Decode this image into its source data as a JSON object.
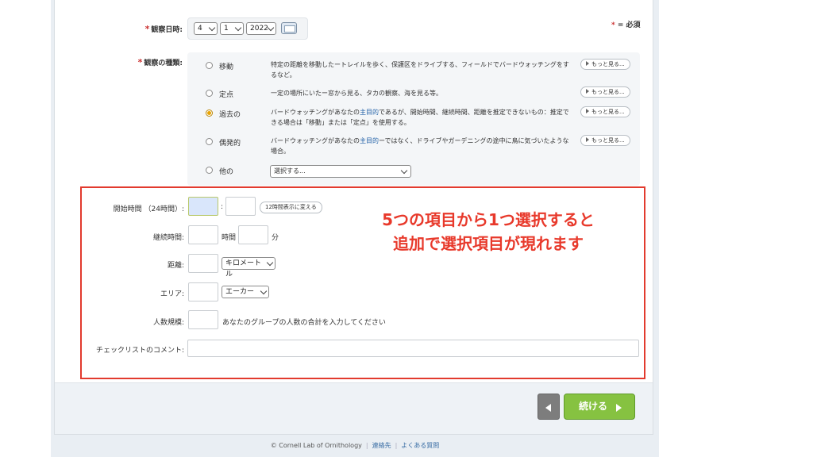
{
  "header": {
    "required_star": "*",
    "required_note": "= 必須"
  },
  "date": {
    "label": "観察日時:",
    "month": "4",
    "day": "1",
    "year": "2022",
    "calendar_icon": "calendar-icon"
  },
  "observation_type": {
    "label": "観察の種類:",
    "options": [
      {
        "name": "移動",
        "desc_before": "特定の距離を移動したートレイルを歩く、保護区をドライブする、フィールドでバードウォッチングをするなど。",
        "desc_link": "",
        "desc_after": "",
        "checked": false
      },
      {
        "name": "定点",
        "desc_before": "一定の場所にいたー窓から見る、タカの観察、海を見る等。",
        "desc_link": "",
        "desc_after": "",
        "checked": false
      },
      {
        "name": "過去の",
        "desc_before": "バードウォッチングがあなたの",
        "desc_link": "主目的",
        "desc_after": "であるが、開始時間、継続時間、距離を推定できないもの：推定できる場合は「移動」または「定点」を使用する。",
        "checked": true
      },
      {
        "name": "偶発的",
        "desc_before": "バードウォッチングがあなたの",
        "desc_link": "主目的",
        "desc_after": "ーではなく、ドライブやガーデニングの途中に鳥に気づいたような場合。",
        "checked": false
      },
      {
        "name": "他の",
        "desc_before": "",
        "desc_link": "",
        "desc_after": "",
        "checked": false
      }
    ],
    "more_label": "もっと見る...",
    "other_select": "選択する..."
  },
  "fields": {
    "start_time_label": "開始時間 （24時間）:",
    "colon": ":",
    "toggle_12h": "12時間表示に変える",
    "duration_label": "継続時間:",
    "hours_unit": "時間",
    "minutes_unit": "分",
    "distance_label": "距離:",
    "distance_unit": "キロメートル",
    "area_label": "エリア:",
    "area_unit": "エーカー",
    "party_label": "人数規模:",
    "party_hint": "あなたのグループの人数の合計を入力してください",
    "comments_label": "チェックリストのコメント:"
  },
  "annotation": {
    "line1": "5つの項目から1つ選択すると",
    "line2": "追加で選択項目が現れます",
    "color": "#e8392b"
  },
  "actions": {
    "back_icon": "chevron-left-icon",
    "next_label": "続ける",
    "next_icon": "chevron-right-icon",
    "accent": "#86c241"
  },
  "footer": {
    "copyright": "© Cornell Lab of Ornithology",
    "contact": "連絡先",
    "faq": "よくある質問"
  }
}
